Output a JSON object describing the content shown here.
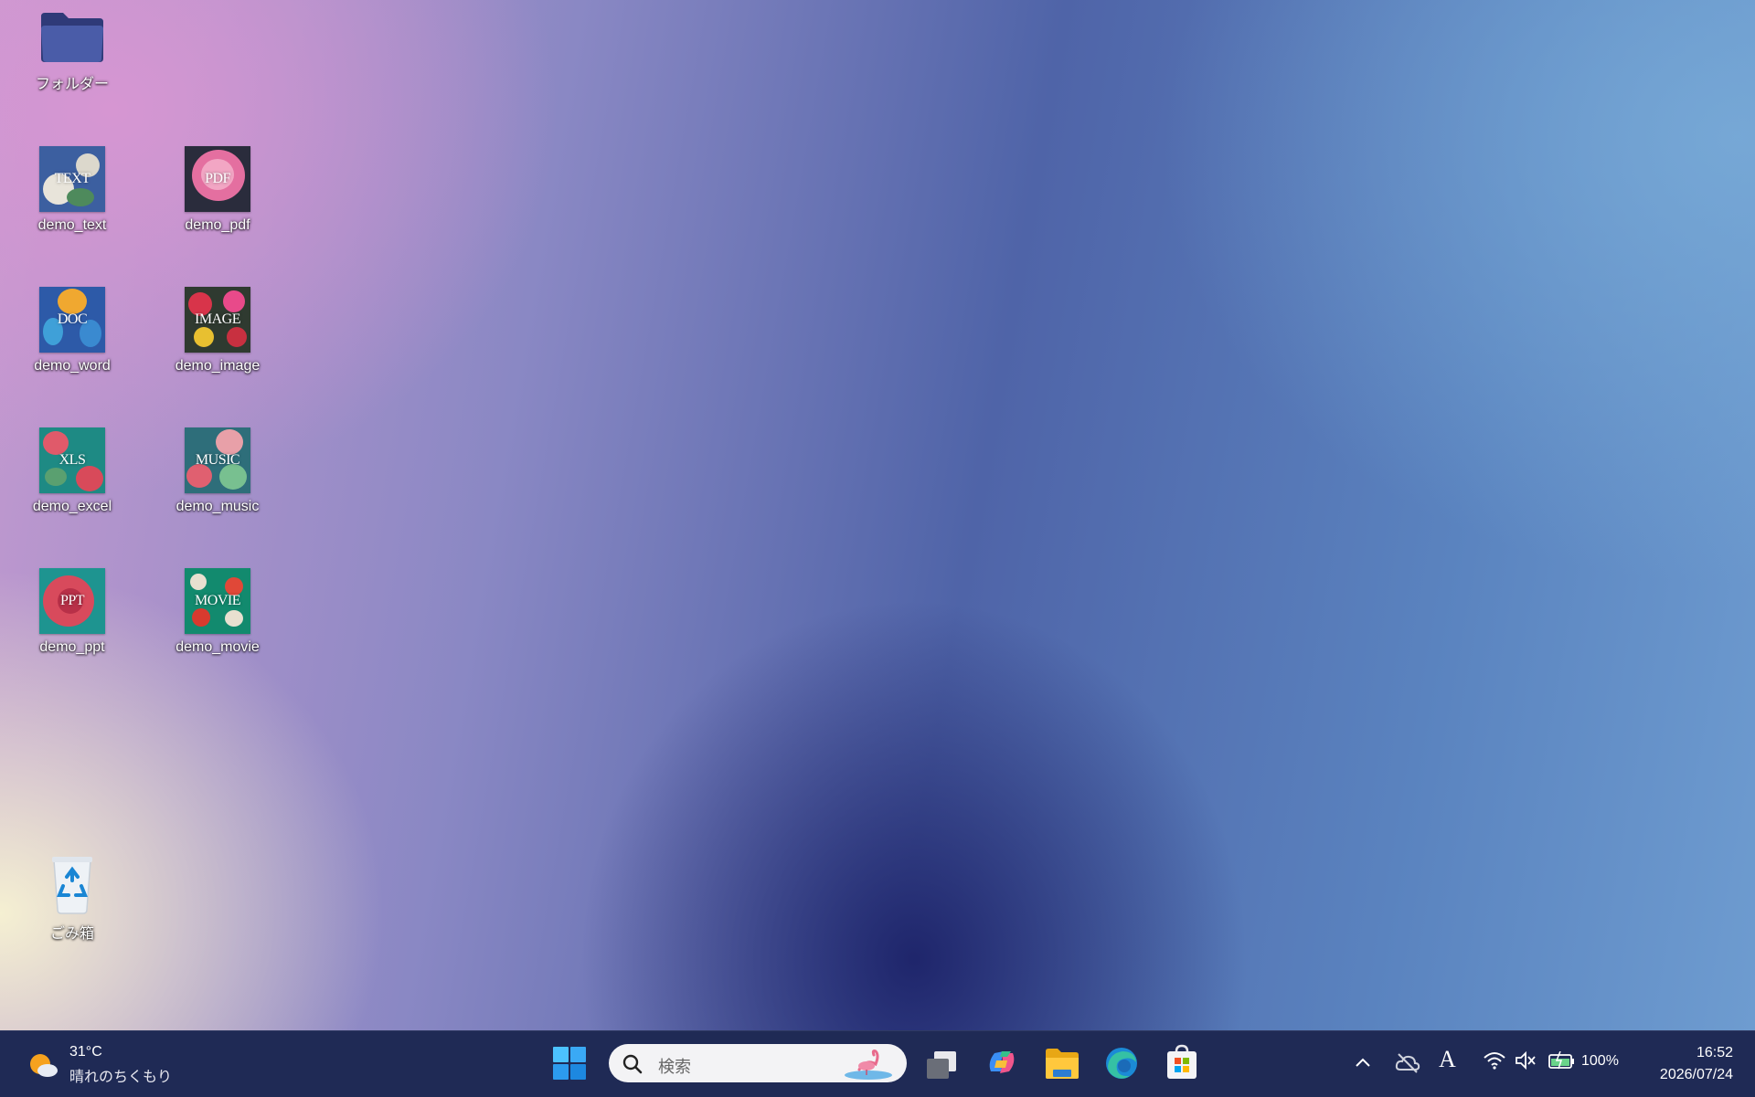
{
  "desktop": {
    "folder": {
      "label": "フォルダー",
      "icon": "folder-icon"
    },
    "icons": [
      {
        "label": "demo_text",
        "tag": "TEXT"
      },
      {
        "label": "demo_pdf",
        "tag": "PDF"
      },
      {
        "label": "demo_word",
        "tag": "DOC"
      },
      {
        "label": "demo_image",
        "tag": "IMAGE"
      },
      {
        "label": "demo_excel",
        "tag": "XLS"
      },
      {
        "label": "demo_music",
        "tag": "MUSIC"
      },
      {
        "label": "demo_ppt",
        "tag": "PPT"
      },
      {
        "label": "demo_movie",
        "tag": "MOVIE"
      }
    ],
    "recycle_bin": {
      "label": "ごみ箱",
      "icon": "recycle-bin-icon"
    }
  },
  "taskbar": {
    "weather": {
      "temp": "31°C",
      "desc": "晴れのちくもり",
      "icon": "weather-sun-cloud-icon"
    },
    "search": {
      "placeholder": "検索"
    },
    "apps": [
      "start-icon",
      "task-view-icon",
      "copilot-icon",
      "file-explorer-icon",
      "edge-icon",
      "store-icon"
    ],
    "tray": {
      "battery": "100%",
      "ime": "A"
    },
    "clock": {
      "time": "16:52",
      "date": "2026/07/24"
    }
  },
  "colors": {
    "taskbar": "#1f2a55",
    "accent": "#0a74d8",
    "folder": "#3b4a8f"
  }
}
